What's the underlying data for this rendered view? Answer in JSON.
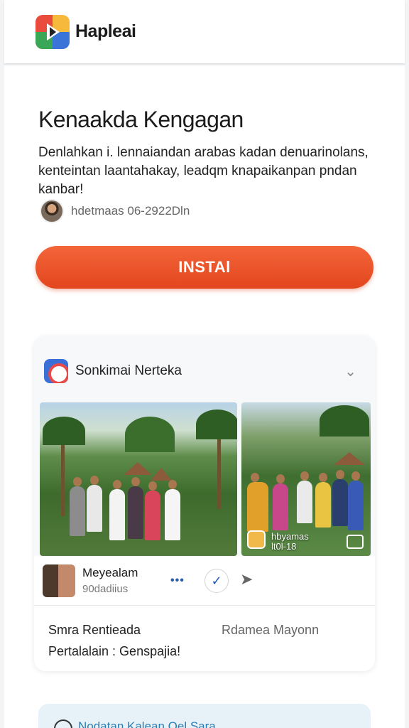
{
  "header": {
    "brand": "Hapleai",
    "logo_icon": "app-logo-icon"
  },
  "main": {
    "title": "Kenaakda Kengagan",
    "description": "Denlahkan i. lennaiandan arabas kadan denuarinolans, kenteintan laantahakay, leadqm knapaikanpan pndan kanbar!",
    "meta_text": "hdetmaas 06-2922Dln",
    "install_label": "INSTAl"
  },
  "card": {
    "title": "Sonkimai Nerteka",
    "photo2_caption_line1": "hbyamas",
    "photo2_caption_line2": "lt0l-18",
    "user": {
      "name": "Meyealam",
      "sub": "90dadiius"
    },
    "footer": {
      "left_line1": "Smra Rentieada",
      "left_line2": "Pertalalain : Genspajia!",
      "right": "Rdamea Mayonn"
    }
  },
  "bottom": {
    "text": "Nodatan Kalean  Oel Sara"
  },
  "colors": {
    "accent": "#e94d22",
    "link": "#2b7db3"
  }
}
